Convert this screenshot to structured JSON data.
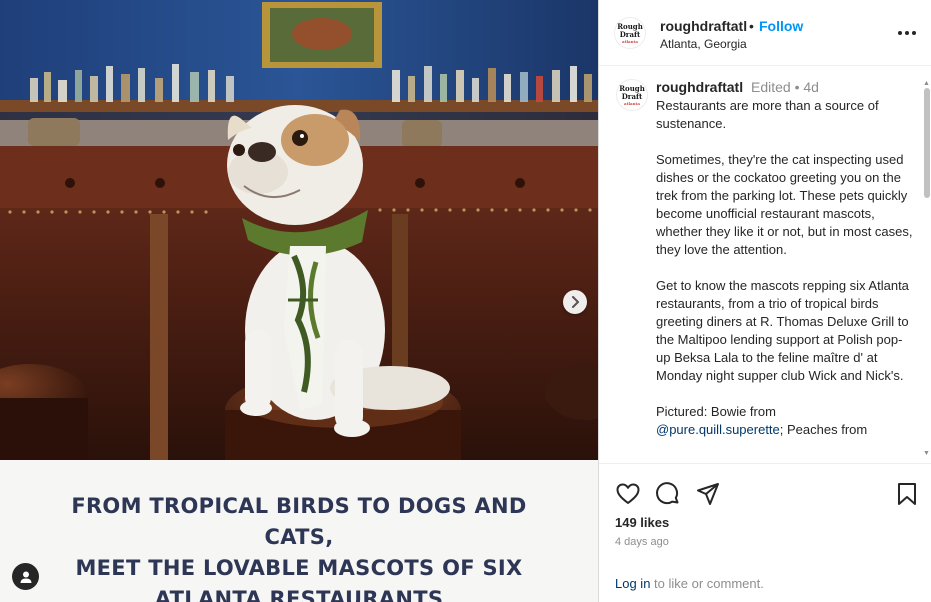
{
  "post": {
    "headline": [
      "FROM TROPICAL BIRDS TO DOGS AND CATS,",
      "MEET THE LOVABLE MASCOTS OF SIX",
      "ATLANTA RESTAURANTS"
    ]
  },
  "logo": {
    "line1": "Rough",
    "line2": "Draft",
    "line3": "atlanta"
  },
  "header": {
    "username": "roughdraftatl",
    "separator": "•",
    "follow_label": "Follow",
    "location": "Atlanta, Georgia"
  },
  "caption": {
    "username": "roughdraftatl",
    "edited": "Edited",
    "separator": "•",
    "age": "4d",
    "paragraphs": [
      "Restaurants are more than a source of sustenance.",
      "Sometimes, they're the cat inspecting used dishes or the cockatoo greeting you on the trek from the parking lot. These pets quickly become unofficial restaurant mascots, whether they like it or not, but in most cases, they love the attention.",
      "Get to know the mascots repping six Atlanta restaurants, from a trio of tropical birds greeting diners at R. Thomas Deluxe Grill to the Maltipoo lending support at Polish pop-up Beksa Lala to the feline maître d' at Monday night supper club Wick and Nick's."
    ],
    "pictured_prefix": "Pictured: Bowie from",
    "pictured_mention": "@pure.quill.superette",
    "pictured_suffix": "; Peaches from"
  },
  "actions": {
    "likes": "149 likes",
    "time_ago": "4 days ago",
    "login_link": "Log in",
    "login_rest": " to like or comment."
  },
  "icons": {
    "like": "heart-icon",
    "comment": "comment-icon",
    "share": "share-icon",
    "save": "bookmark-icon",
    "more": "more-dots-icon",
    "next": "chevron-right-icon",
    "tags": "user-tag-icon"
  },
  "colors": {
    "follow": "#0095f6",
    "headline": "#2e3656",
    "link": "#00376b",
    "muted": "#8e8e8e"
  }
}
